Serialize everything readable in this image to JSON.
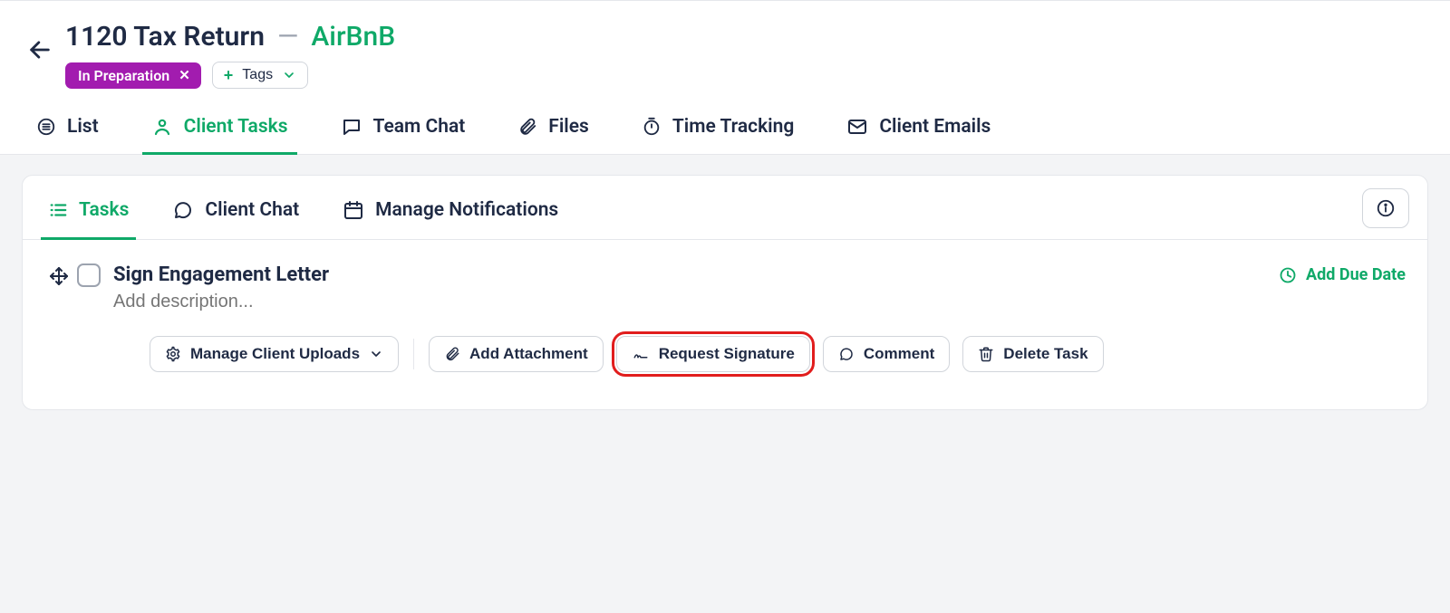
{
  "header": {
    "title": "1120 Tax Return",
    "separator": "—",
    "client_name": "AirBnB",
    "status_label": "In Preparation",
    "tags_button_label": "Tags"
  },
  "primary_tabs": {
    "list": "List",
    "client_tasks": "Client Tasks",
    "team_chat": "Team Chat",
    "files": "Files",
    "time_tracking": "Time Tracking",
    "client_emails": "Client Emails"
  },
  "sub_tabs": {
    "tasks": "Tasks",
    "client_chat": "Client Chat",
    "manage_notifications": "Manage Notifications"
  },
  "task": {
    "title": "Sign Engagement Letter",
    "description_placeholder": "Add description...",
    "add_due_date": "Add Due Date"
  },
  "actions": {
    "manage_uploads": "Manage Client Uploads",
    "add_attachment": "Add Attachment",
    "request_signature": "Request Signature",
    "comment": "Comment",
    "delete_task": "Delete Task"
  }
}
